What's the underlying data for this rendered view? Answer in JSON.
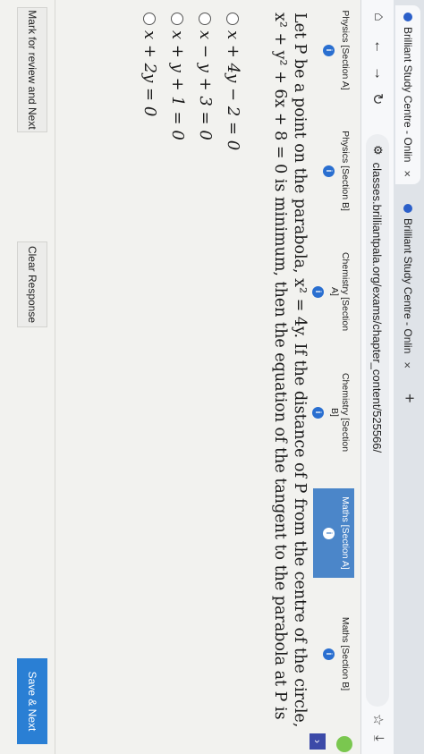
{
  "browser": {
    "tabs": [
      {
        "title": "Brilliant Study Centre - Onlin",
        "close": "×",
        "active": true
      },
      {
        "title": "Brilliant Study Centre - Onlin",
        "close": "×",
        "active": false
      }
    ],
    "new_tab": "+",
    "url": "classes.brilliantpala.org/exams/chapter_content/525566/"
  },
  "sections": [
    {
      "label": "Physics [Section A]",
      "info": "i",
      "selected": false
    },
    {
      "label": "Physics [Section B]",
      "info": "i",
      "selected": false
    },
    {
      "label": "Chemistry [Section A]",
      "info": "i",
      "selected": false
    },
    {
      "label": "Chemistry [Section B]",
      "info": "i",
      "selected": false
    },
    {
      "label": "Maths [Section A]",
      "info": "i",
      "selected": true
    },
    {
      "label": "Maths [Section B]",
      "info": "i",
      "selected": false
    }
  ],
  "question": {
    "text": "Let P be a point on the parabola, x² = 4y. If the distance of P from the centre of the circle, x² + y² + 6x + 8 = 0 is minimum, then the equation of the tangent to the parabola at P is"
  },
  "options": [
    {
      "label": "x + 4y − 2 = 0"
    },
    {
      "label": "x − y + 3 = 0"
    },
    {
      "label": "x + y + 1 = 0"
    },
    {
      "label": "x + 2y = 0"
    }
  ],
  "actions": {
    "mark_review": "Mark for review and Next",
    "clear": "Clear Response",
    "save_next": "Save & Next"
  },
  "colors": {
    "accent": "#2a7fd4",
    "selected_section": "#4b86c9"
  }
}
